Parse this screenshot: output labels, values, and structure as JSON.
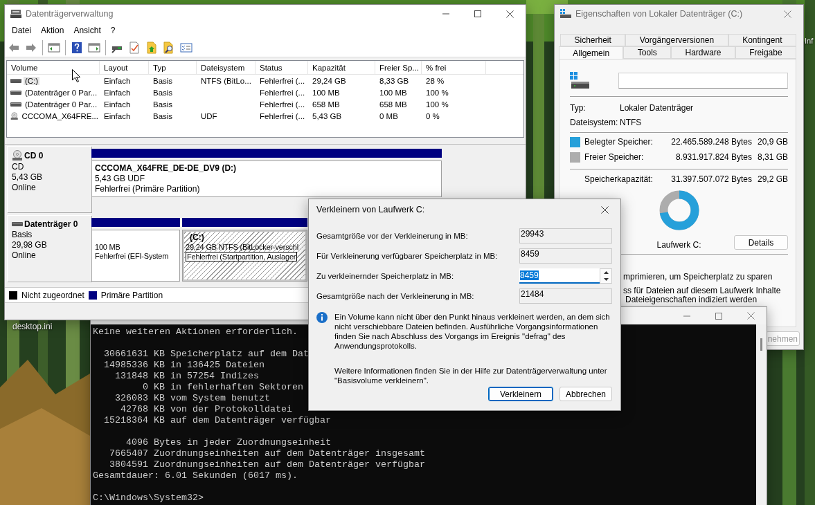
{
  "desktop": {
    "icons": [
      {
        "label": "desktop.ini"
      },
      {
        "label": "Inf"
      }
    ]
  },
  "disk_management": {
    "title": "Datenträgerverwaltung",
    "menu": [
      "Datei",
      "Aktion",
      "Ansicht",
      "?"
    ],
    "columns": [
      "Volume",
      "Layout",
      "Typ",
      "Dateisystem",
      "Status",
      "Kapazität",
      "Freier Sp...",
      "% frei"
    ],
    "volumes": [
      {
        "kind": "disk",
        "selected": true,
        "cells": [
          "(C:)",
          "Einfach",
          "Basis",
          "NTFS (BitLo...",
          "Fehlerfrei (...",
          "29,24 GB",
          "8,33 GB",
          "28 %"
        ]
      },
      {
        "kind": "disk",
        "selected": false,
        "cells": [
          "(Datenträger 0 Par...",
          "Einfach",
          "Basis",
          "",
          "Fehlerfrei (...",
          "100 MB",
          "100 MB",
          "100 %"
        ]
      },
      {
        "kind": "disk",
        "selected": false,
        "cells": [
          "(Datenträger 0 Par...",
          "Einfach",
          "Basis",
          "",
          "Fehlerfrei (...",
          "658 MB",
          "658 MB",
          "100 %"
        ]
      },
      {
        "kind": "cd",
        "selected": false,
        "cells": [
          "CCCOMA_X64FRE...",
          "Einfach",
          "Basis",
          "UDF",
          "Fehlerfrei (...",
          "5,43 GB",
          "0 MB",
          "0 %"
        ]
      }
    ],
    "disks": [
      {
        "kind": "cd",
        "name": "CD 0",
        "lines": [
          "CD",
          "5,43 GB",
          "Online"
        ],
        "partitions": [
          {
            "selected": false,
            "title": "CCCOMA_X64FRE_DE-DE_DV9  (D:)",
            "lines": [
              "5,43 GB UDF",
              "Fehlerfrei (Primäre Partition)"
            ]
          }
        ]
      },
      {
        "kind": "disk",
        "name": "Datenträger 0",
        "lines": [
          "Basis",
          "29,98 GB",
          "Online"
        ],
        "partitions": [
          {
            "selected": false,
            "lines": [
              "100 MB",
              "Fehlerfrei (EFI-System"
            ]
          },
          {
            "selected": true,
            "title": "(C:)",
            "lines": [
              "29,24 GB NTFS (BitLocker-verschl",
              "Fehlerfrei (Startpartition, Auslager"
            ]
          }
        ]
      }
    ],
    "legend": [
      {
        "label": "Nicht zugeordnet",
        "color": "#000000"
      },
      {
        "label": "Primäre Partition",
        "color": "#000080"
      }
    ]
  },
  "properties": {
    "title": "Eigenschaften von Lokaler Datenträger (C:)",
    "tab_rows": [
      {
        "tabs": [
          {
            "label": "Sicherheit",
            "selected": false
          },
          {
            "label": "Vorgängerversionen",
            "selected": false
          },
          {
            "label": "Kontingent",
            "selected": false
          }
        ]
      },
      {
        "tabs": [
          {
            "label": "Allgemein",
            "selected": true
          },
          {
            "label": "Tools",
            "selected": false
          },
          {
            "label": "Hardware",
            "selected": false
          },
          {
            "label": "Freigabe",
            "selected": false
          }
        ]
      }
    ],
    "details": [
      {
        "label": "Typ:",
        "value": "Lokaler Datenträger"
      },
      {
        "label": "Dateisystem:",
        "value": "NTFS"
      }
    ],
    "usage": [
      {
        "label": "Belegter Speicher:",
        "bytes": "22.465.589.248 Bytes",
        "size": "20,9 GB",
        "color": "#26a0da"
      },
      {
        "label": "Freier Speicher:",
        "bytes": "8.931.917.824 Bytes",
        "size": "8,31 GB",
        "color": "#adadad"
      }
    ],
    "capacity": {
      "label": "Speicherkapazität:",
      "bytes": "31.397.507.072 Bytes",
      "size": "29,2 GB"
    },
    "usage_chart": {
      "level": 0.72,
      "caption": "Laufwerk C:"
    },
    "details_button": "Details",
    "options": [
      "mprimieren, um Speicherplatz zu sparen",
      "ss für Dateien auf diesem Laufwerk Inhalte",
      "Dateieigenschaften indiziert werden"
    ],
    "buttons": [
      {
        "label": "nehmen",
        "disabled": true
      }
    ]
  },
  "console": {
    "blocks": [
      {
        "lines": [
          "Keine weiteren Aktionen erforderlich."
        ]
      },
      {
        "lines": [
          "  30661631 KB Speicherplatz auf dem Dat",
          "  14985336 KB in 136425 Dateien",
          "    131848 KB in 57254 Indizes",
          "         0 KB in fehlerhaften Sektoren",
          "    326083 KB vom System benutzt",
          "     42768 KB von der Protokolldatei",
          "  15218364 KB auf dem Datenträger verfügbar"
        ]
      },
      {
        "lines": [
          "      4096 Bytes in jeder Zuordnungseinheit",
          "   7665407 Zuordnungseinheiten auf dem Datenträger insgesamt",
          "   3804591 Zuordnungseinheiten auf dem Datenträger verfügbar",
          "Gesamtdauer: 6.01 Sekunden (6017 ms)."
        ]
      },
      {
        "lines": [
          "C:\\Windows\\System32>"
        ]
      }
    ]
  },
  "shrink_dialog": {
    "title": "Verkleinern von Laufwerk C:",
    "fields": [
      {
        "label": "Gesamtgröße vor der Verkleinerung in MB:",
        "value": "29943",
        "kind": "readonly",
        "selected": false
      },
      {
        "label": "Für Verkleinerung verfügbarer Speicherplatz in MB:",
        "value": "8459",
        "kind": "readonly",
        "selected": false
      },
      {
        "label": "Zu verkleinernder Speicherplatz in MB:",
        "value": "8459",
        "kind": "spin",
        "selected": true
      },
      {
        "label": "Gesamtgröße nach der Verkleinerung in MB:",
        "value": "21484",
        "kind": "readonly",
        "selected": false
      }
    ],
    "info": "Ein Volume kann nicht über den Punkt hinaus verkleinert werden, an dem sich nicht verschiebbare Dateien befinden. Ausführliche Vorgangsinformationen finden Sie nach Abschluss des Vorgangs im Ereignis \"defrag\" des Anwendungsprotokolls.",
    "help": "Weitere Informationen finden Sie in der Hilfe zur Datenträgerverwaltung unter \"Basisvolume verkleinern\".",
    "buttons": [
      {
        "label": "Verkleinern",
        "default": true
      },
      {
        "label": "Abbrechen",
        "default": false
      }
    ]
  }
}
